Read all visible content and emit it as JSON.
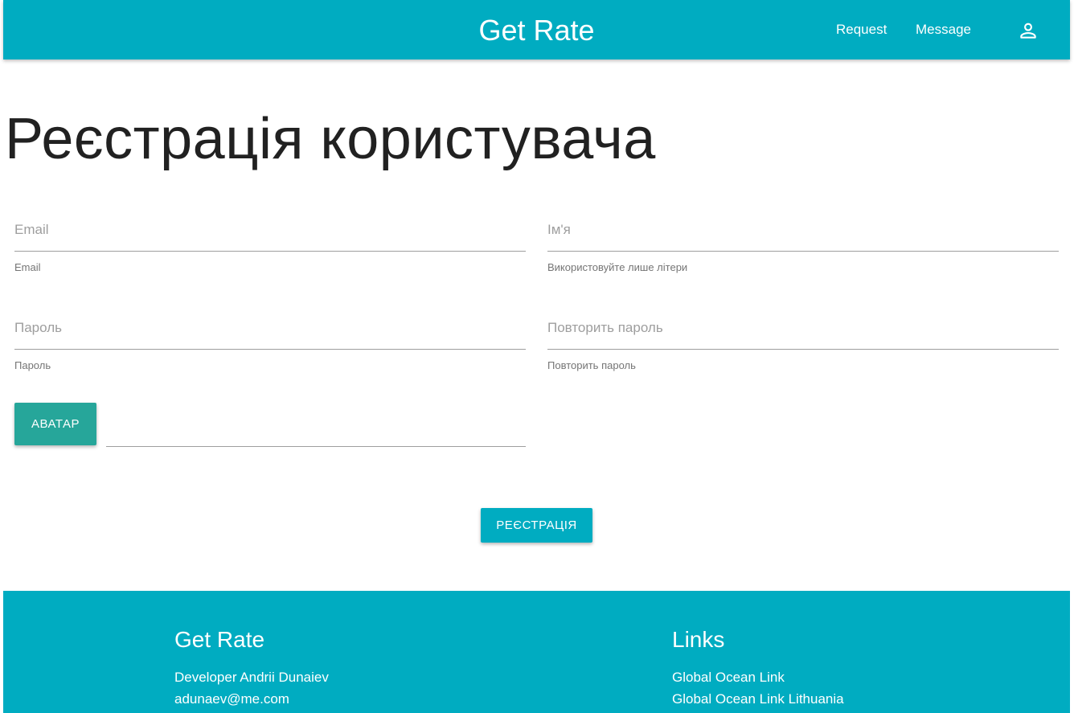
{
  "navbar": {
    "brand": "Get Rate",
    "links": [
      "Request",
      "Message"
    ],
    "user_icon": "account-outline-icon",
    "color": "#00acc1"
  },
  "page_title": "Реєстрація користувача",
  "form": {
    "email": {
      "placeholder": "Email",
      "helper": "Email",
      "value": ""
    },
    "name": {
      "placeholder": "Ім'я",
      "helper": "Використовуйте лише літери",
      "value": ""
    },
    "password": {
      "placeholder": "Пароль",
      "helper": "Пароль",
      "value": ""
    },
    "password_repeat": {
      "placeholder": "Повторить пароль",
      "helper": "Повторить пароль",
      "value": ""
    },
    "avatar_button": "АВАТАР",
    "avatar_path": "",
    "submit_button": "РЕЄСТРАЦІЯ",
    "avatar_button_color": "#26a69a"
  },
  "footer": {
    "brand": "Get Rate",
    "developer": "Developer Andrii Dunaiev",
    "email": "adunaev@me.com",
    "links_title": "Links",
    "links": [
      "Global Ocean Link",
      "Global Ocean Link Lithuania"
    ]
  }
}
